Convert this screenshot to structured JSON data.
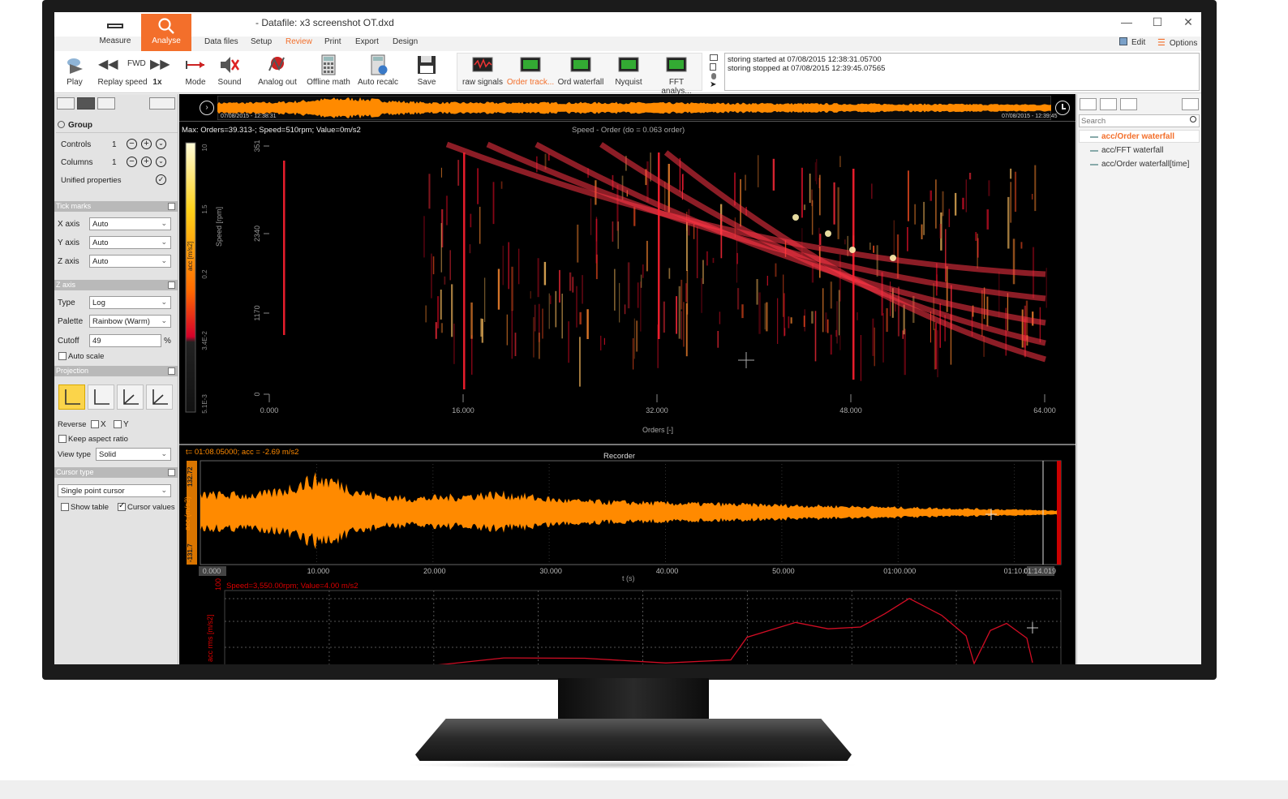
{
  "window": {
    "title": "Datafile: x3 screenshot OT.dxd",
    "title_prefix": "-"
  },
  "mode_tabs": [
    {
      "label": "Measure"
    },
    {
      "label": "Analyse"
    }
  ],
  "menu": [
    "Data files",
    "Setup",
    "Review",
    "Print",
    "Export",
    "Design"
  ],
  "right_options": {
    "edit": "Edit",
    "options": "Options"
  },
  "toolbar": {
    "play": "Play",
    "fwd": "FWD",
    "replay_speed_label": "Replay speed",
    "replay_speed_value": "1x",
    "mode": "Mode",
    "sound": "Sound",
    "analog_out": "Analog out",
    "offline_math": "Offline math",
    "auto_recalc": "Auto recalc",
    "save": "Save",
    "views": [
      "raw signals",
      "Order track...",
      "Ord waterfall",
      "Nyquist",
      "FFT analys..."
    ]
  },
  "log": [
    "storing started at 07/08/2015 12:38:31.05700",
    "storing stopped at 07/08/2015 12:39:45.07565"
  ],
  "overview": {
    "start": "07/08/2015 - 12:38:31",
    "end": "07/08/2015 - 12:39:45"
  },
  "left_panel": {
    "group_title": "Group",
    "controls_label": "Controls",
    "controls_value": "1",
    "columns_label": "Columns",
    "columns_value": "1",
    "unified": "Unified properties",
    "tick_marks_header": "Tick marks",
    "x_axis_label": "X axis",
    "x_axis_value": "Auto",
    "y_axis_label": "Y axis",
    "y_axis_value": "Auto",
    "z_axis_label": "Z axis",
    "z_axis_value": "Auto",
    "z_axis_header": "Z axis",
    "type_label": "Type",
    "type_value": "Log",
    "palette_label": "Palette",
    "palette_value": "Rainbow (Warm)",
    "cutoff_label": "Cutoff",
    "cutoff_value": "49",
    "cutoff_unit": "%",
    "auto_scale": "Auto scale",
    "projection_header": "Projection",
    "reverse_label": "Reverse",
    "reverse_x": "X",
    "reverse_y": "Y",
    "keep_aspect": "Keep aspect ratio",
    "view_type_label": "View type",
    "view_type_value": "Solid",
    "cursor_type_header": "Cursor type",
    "cursor_type_value": "Single point cursor",
    "show_table": "Show table",
    "cursor_values": "Cursor values"
  },
  "waterfall": {
    "info": "Max: Orders=39.313-; Speed=510rpm; Value=0m/s2",
    "title": "Speed - Order (do = 0.063 order)",
    "xlabel": "Orders [-]",
    "ylabel": "Speed [rpm]",
    "xticks": [
      "0.000",
      "16.000",
      "32.000",
      "48.000",
      "64.000"
    ],
    "yticks": [
      "351",
      "2340",
      "1170",
      "0"
    ],
    "zticks": [
      "10",
      "1.5",
      "0.2",
      "3.4E-2",
      "5.1E-3"
    ],
    "zunit": "acc [m/s2]"
  },
  "recorder": {
    "info": "t= 01:08.05000; acc = -2.69 m/s2",
    "title": "Recorder",
    "xlabel": "t (s)",
    "ylabel": "acc (m/s2)",
    "ymax": "132.72",
    "ymin": "-131.7",
    "xticks": [
      "0.000",
      "10.000",
      "20.000",
      "30.000",
      "40.000",
      "50.000",
      "01:00.000",
      "01:10.0",
      "01:14.019"
    ]
  },
  "bottom_plot": {
    "info": "Speed=3,550.00rpm; Value=4.00 m/s2",
    "ylabel": "acc rms [m/s2]",
    "ytick": "100"
  },
  "right_panel": {
    "search_placeholder": "Search",
    "items": [
      "acc/Order waterfall",
      "acc/FFT waterfall",
      "acc/Order waterfall[time]"
    ]
  },
  "colors": {
    "accent": "#f36f2b",
    "signal": "#ff8a00",
    "order_red": "#e0102a"
  }
}
